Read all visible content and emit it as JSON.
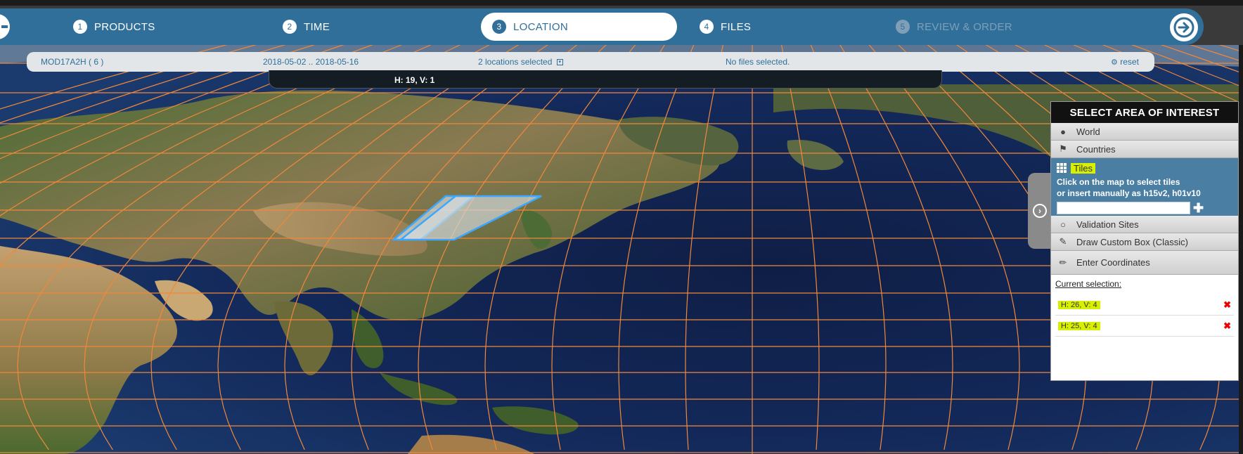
{
  "wizard": {
    "steps": [
      {
        "num": "1",
        "label": "PRODUCTS"
      },
      {
        "num": "2",
        "label": "TIME"
      },
      {
        "num": "3",
        "label": "LOCATION"
      },
      {
        "num": "4",
        "label": "FILES"
      },
      {
        "num": "5",
        "label": "REVIEW & ORDER"
      }
    ],
    "active_step": "LOCATION",
    "next_icon": "arrow-right-icon",
    "back_icon": "arrow-left-icon",
    "accent_color": "#2f6f9a"
  },
  "summary": {
    "product": "MOD17A2H ( 6 )",
    "dates": "2018-05-02 .. 2018-05-16",
    "locations": "2 locations selected",
    "files": "No files selected.",
    "reset": "reset"
  },
  "hover_tile": "H: 19, V: 1",
  "panel": {
    "title": "SELECT AREA OF INTEREST",
    "options": {
      "world": "World",
      "countries": "Countries",
      "tiles": "Tiles",
      "tiles_help_1": "Click on the map to select tiles",
      "tiles_help_2": "or insert manually as h15v2, h01v10",
      "tiles_input_value": "",
      "validation": "Validation Sites",
      "custom_box": "Draw Custom Box (Classic)",
      "coordinates": "Enter Coordinates"
    },
    "current_selection_title": "Current selection:",
    "selection": [
      {
        "label": "H: 26, V: 4"
      },
      {
        "label": "H: 25, V: 4"
      }
    ],
    "highlight_color": "#d7f000"
  },
  "map": {
    "grid_color": "#f0883a",
    "selection_color": "#3aa8ff"
  }
}
